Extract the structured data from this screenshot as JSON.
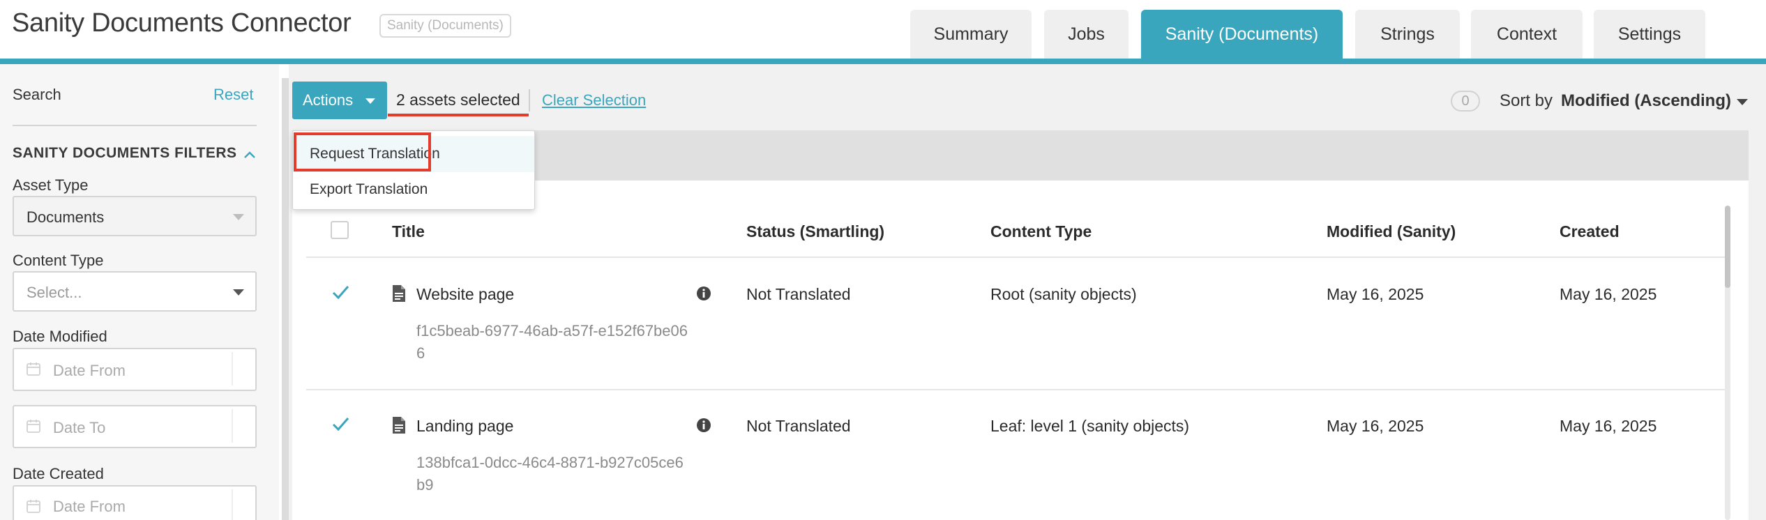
{
  "header": {
    "title": "Sanity Documents Connector",
    "badge": "Sanity (Documents)",
    "tabs": [
      {
        "label": "Summary"
      },
      {
        "label": "Jobs"
      },
      {
        "label": "Sanity (Documents)",
        "active": true
      },
      {
        "label": "Strings"
      },
      {
        "label": "Context"
      },
      {
        "label": "Settings"
      }
    ]
  },
  "sidebar": {
    "search_label": "Search",
    "reset_label": "Reset",
    "section_title": "SANITY DOCUMENTS FILTERS",
    "asset_type": {
      "label": "Asset Type",
      "value": "Documents"
    },
    "content_type": {
      "label": "Content Type",
      "placeholder": "Select..."
    },
    "date_modified": {
      "label": "Date Modified",
      "from_placeholder": "Date From",
      "to_placeholder": "Date To"
    },
    "date_created": {
      "label": "Date Created",
      "from_placeholder": "Date From"
    }
  },
  "toolbar": {
    "actions_label": "Actions",
    "selected_text": "2 assets selected",
    "clear_selection": "Clear Selection",
    "count": "0",
    "sort_label": "Sort by",
    "sort_value": "Modified (Ascending)"
  },
  "actions_menu": {
    "items": [
      "Request Translation",
      "Export Translation"
    ],
    "highlighted": "Request Translation"
  },
  "table": {
    "columns": [
      "Title",
      "Status (Smartling)",
      "Content Type",
      "Modified (Sanity)",
      "Created"
    ],
    "rows": [
      {
        "checked": true,
        "title": "Website page",
        "id_line1": "f1c5beab-6977-46ab-a57f-e152f67be06",
        "id_line2": "6",
        "status": "Not Translated",
        "content_type": "Root (sanity objects)",
        "modified": "May 16, 2025",
        "created": "May 16, 2025"
      },
      {
        "checked": true,
        "title": "Landing page",
        "id_line1": "138bfca1-0dcc-46c4-8871-b927c05ce6",
        "id_line2": "b9",
        "status": "Not Translated",
        "content_type": "Leaf: level 1 (sanity objects)",
        "modified": "May 16, 2025",
        "created": "May 16, 2025"
      }
    ]
  },
  "colors": {
    "accent": "#3aa6bd",
    "highlight": "#e53b2c"
  }
}
